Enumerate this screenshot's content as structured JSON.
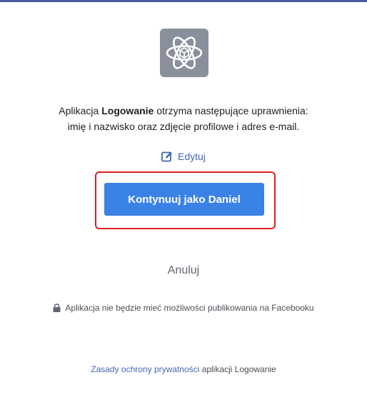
{
  "app": {
    "name": "Logowanie",
    "icon": "atom-icon",
    "icon_bg": "#8a909b"
  },
  "permissions": {
    "prefix": "Aplikacja ",
    "app_name": "Logowanie",
    "suffix": " otrzyma następujące uprawnienia:",
    "line2": "imię i nazwisko oraz zdjęcie profilowe i adres e-mail."
  },
  "edit": {
    "label": "Edytuj",
    "icon": "edit-icon"
  },
  "continue_button": {
    "label": "Kontynuuj jako Daniel",
    "color": "#3b82e6"
  },
  "highlight_color": "#e0201e",
  "cancel": {
    "label": "Anuluj"
  },
  "notice": {
    "icon": "lock-icon",
    "text": "Aplikacja nie będzie mieć możliwości publikowania na Facebooku"
  },
  "footer": {
    "link_text": "Zasady ochrony prywatności",
    "suffix": " aplikacji Logowanie"
  },
  "colors": {
    "link": "#4267b2",
    "top_bar": "#4a5a9c"
  }
}
